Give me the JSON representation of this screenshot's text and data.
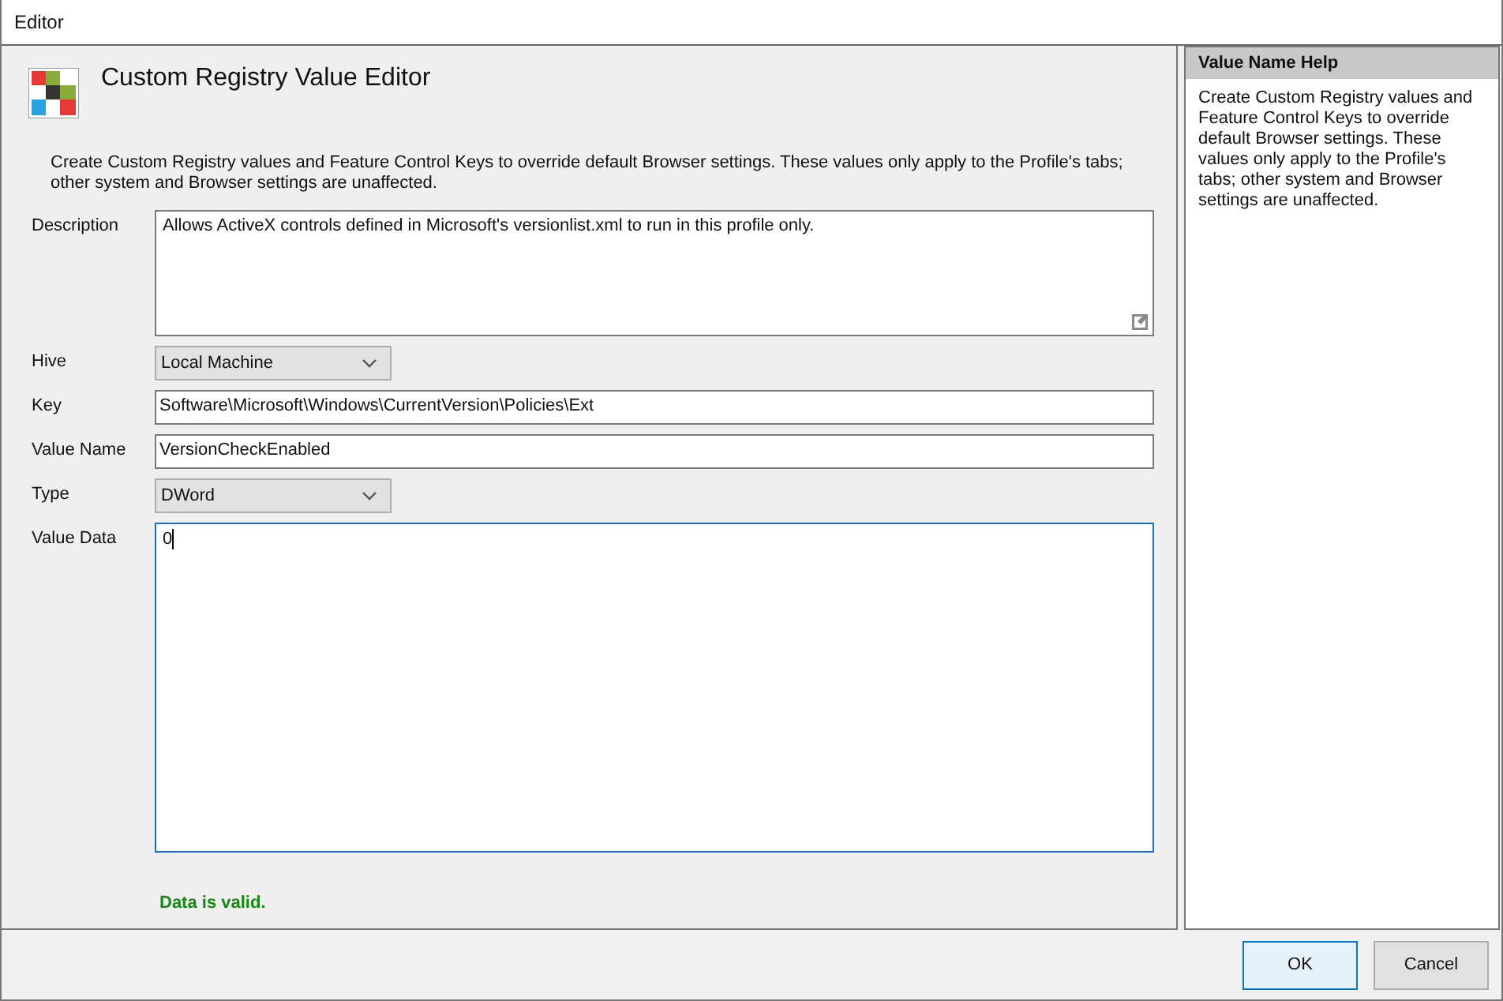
{
  "window": {
    "title": "Editor"
  },
  "header": {
    "title": "Custom Registry Value Editor",
    "intro": "Create Custom Registry values and Feature Control Keys to override default Browser settings. These values only apply to the Profile's tabs; other system and Browser settings are unaffected."
  },
  "fields": [
    {
      "label": "Description",
      "kind": "multiline",
      "value": "Allows ActiveX controls defined in Microsoft's versionlist.xml to run in this profile only.",
      "focused": false,
      "expandable": true
    },
    {
      "label": "Hive",
      "kind": "dropdown",
      "value": "Local Machine",
      "focused": false
    },
    {
      "label": "Key",
      "kind": "text",
      "value": "Software\\Microsoft\\Windows\\CurrentVersion\\Policies\\Ext",
      "focused": false
    },
    {
      "label": "Value Name",
      "kind": "text",
      "value": "VersionCheckEnabled",
      "focused": false
    },
    {
      "label": "Type",
      "kind": "dropdown",
      "value": "DWord",
      "focused": false
    },
    {
      "label": "Value Data",
      "kind": "data",
      "value": "0",
      "focused": true
    }
  ],
  "validation": {
    "message": "Data is valid.",
    "valid": true
  },
  "help": {
    "title": "Value Name Help",
    "text": "Create Custom Registry values and Feature Control Keys to override default Browser settings. These values only apply to the Profile's tabs; other system and Browser settings are unaffected."
  },
  "buttons": [
    {
      "label": "OK",
      "default": true
    },
    {
      "label": "Cancel",
      "default": false
    }
  ]
}
